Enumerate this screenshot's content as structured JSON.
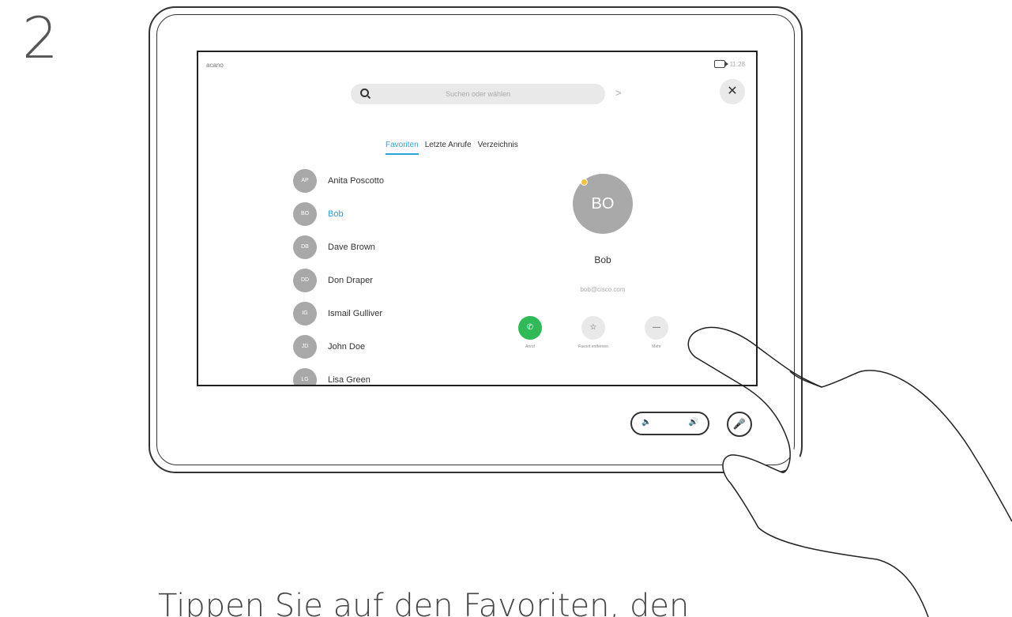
{
  "step": "2",
  "status": {
    "left": "acano",
    "time": "11:28"
  },
  "search": {
    "placeholder": "Suchen oder wählen"
  },
  "tabs": [
    {
      "label": "Favoriten",
      "active": true
    },
    {
      "label": "Letzte Anrufe",
      "active": false
    },
    {
      "label": "Verzeichnis",
      "active": false
    }
  ],
  "contacts": [
    {
      "initials": "AP",
      "name": "Anita Poscotto",
      "selected": false
    },
    {
      "initials": "BO",
      "name": "Bob",
      "selected": true
    },
    {
      "initials": "DB",
      "name": "Dave Brown",
      "selected": false
    },
    {
      "initials": "DD",
      "name": "Don Draper",
      "selected": false
    },
    {
      "initials": "IG",
      "name": "Ismail Gulliver",
      "selected": false
    },
    {
      "initials": "JD",
      "name": "John Doe",
      "selected": false
    },
    {
      "initials": "LG",
      "name": "Lisa Green",
      "selected": false
    }
  ],
  "detail": {
    "initials": "BO",
    "name": "Bob",
    "email": "bob@cisco.com",
    "actions": [
      {
        "icon": "call-icon",
        "glyph": "✆",
        "label": "Anruf"
      },
      {
        "icon": "star-icon",
        "glyph": "☆",
        "label": "Favorit entfernen"
      },
      {
        "icon": "more-icon",
        "glyph": "—",
        "label": "Mehr"
      }
    ]
  },
  "volume": {
    "low_icon": "🔈",
    "high_icon": "🔊"
  },
  "mute_icon": "🎤",
  "caption": "Tippen Sie auf den Favoriten, den",
  "colors": {
    "accent": "#2da3d8",
    "call": "#2fba57",
    "presence": "#f5c23c"
  }
}
